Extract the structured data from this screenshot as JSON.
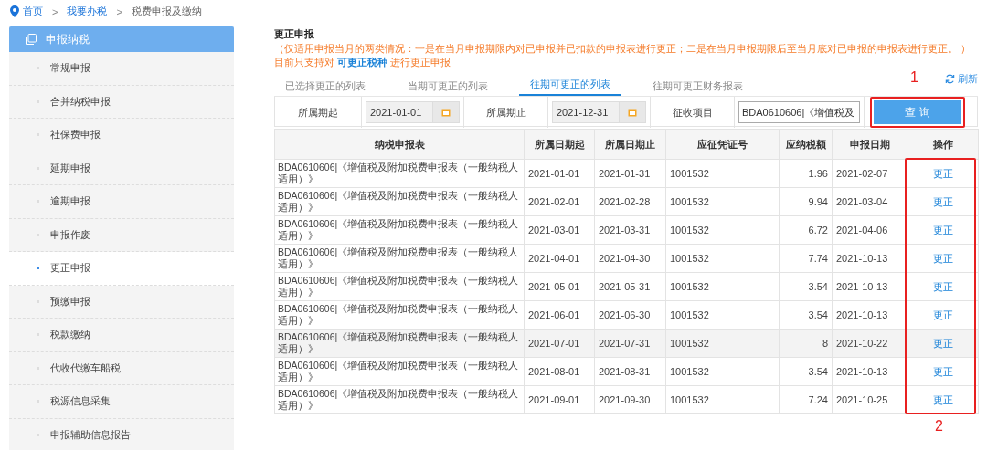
{
  "breadcrumb": [
    {
      "label": "首页",
      "link": true
    },
    {
      "label": "我要办税",
      "link": true
    },
    {
      "label": "税费申报及缴纳",
      "link": false
    }
  ],
  "breadcrumb_separator": ">",
  "sidebar": {
    "title": "申报纳税",
    "items": [
      {
        "label": "常规申报",
        "selected": false
      },
      {
        "label": "合并纳税申报",
        "selected": false
      },
      {
        "label": "社保费申报",
        "selected": false
      },
      {
        "label": "延期申报",
        "selected": false
      },
      {
        "label": "逾期申报",
        "selected": false
      },
      {
        "label": "申报作废",
        "selected": false
      },
      {
        "label": "更正申报",
        "selected": true
      },
      {
        "label": "预缴申报",
        "selected": false
      },
      {
        "label": "税款缴纳",
        "selected": false
      },
      {
        "label": "代收代缴车船税",
        "selected": false
      },
      {
        "label": "税源信息采集",
        "selected": false
      },
      {
        "label": "申报辅助信息报告",
        "selected": false
      }
    ]
  },
  "page_title": "更正申报",
  "notice": "（仅适用申报当月的两类情况：一是在当月申报期限内对已申报并已扣款的申报表进行更正；二是在当月申报期限后至当月底对已申报的申报表进行更正。 ）",
  "support_note": {
    "before": "目前只支持对",
    "link": "可更正税种",
    "after": "进行更正申报"
  },
  "tabs": [
    {
      "label": "已选择更正的列表",
      "selected": false
    },
    {
      "label": "当期可更正的列表",
      "selected": false
    },
    {
      "label": "往期可更正的列表",
      "selected": true
    },
    {
      "label": "往期可更正财务报表",
      "selected": false
    }
  ],
  "refresh": "刷新",
  "filters": {
    "start_label": "所属期起",
    "start_value": "2021-01-01",
    "end_label": "所属期止",
    "end_value": "2021-12-31",
    "item_label": "征收项目",
    "item_value": "BDA0610606|《增值税及",
    "query_button": "查 询"
  },
  "table": {
    "columns": [
      "纳税申报表",
      "所属日期起",
      "所属日期止",
      "应征凭证号",
      "应纳税额",
      "申报日期",
      "操作"
    ],
    "rows": [
      {
        "form": "BDA0610606|《增值税及附加税费申报表（一般纳税人适用）》",
        "start": "2021-01-01",
        "end": "2021-01-31",
        "voucher": "1001532",
        "amount": "1.96",
        "date": "2021-02-07",
        "action": "更正",
        "selected": false
      },
      {
        "form": "BDA0610606|《增值税及附加税费申报表（一般纳税人适用）》",
        "start": "2021-02-01",
        "end": "2021-02-28",
        "voucher": "1001532",
        "amount": "9.94",
        "date": "2021-03-04",
        "action": "更正",
        "selected": false
      },
      {
        "form": "BDA0610606|《增值税及附加税费申报表（一般纳税人适用）》",
        "start": "2021-03-01",
        "end": "2021-03-31",
        "voucher": "1001532",
        "amount": "6.72",
        "date": "2021-04-06",
        "action": "更正",
        "selected": false
      },
      {
        "form": "BDA0610606|《增值税及附加税费申报表（一般纳税人适用）》",
        "start": "2021-04-01",
        "end": "2021-04-30",
        "voucher": "1001532",
        "amount": "7.74",
        "date": "2021-10-13",
        "action": "更正",
        "selected": false
      },
      {
        "form": "BDA0610606|《增值税及附加税费申报表（一般纳税人适用）》",
        "start": "2021-05-01",
        "end": "2021-05-31",
        "voucher": "1001532",
        "amount": "3.54",
        "date": "2021-10-13",
        "action": "更正",
        "selected": false
      },
      {
        "form": "BDA0610606|《增值税及附加税费申报表（一般纳税人适用）》",
        "start": "2021-06-01",
        "end": "2021-06-30",
        "voucher": "1001532",
        "amount": "3.54",
        "date": "2021-10-13",
        "action": "更正",
        "selected": false
      },
      {
        "form": "BDA0610606|《增值税及附加税费申报表（一般纳税人适用）》",
        "start": "2021-07-01",
        "end": "2021-07-31",
        "voucher": "1001532",
        "amount": "8",
        "date": "2021-10-22",
        "action": "更正",
        "selected": true
      },
      {
        "form": "BDA0610606|《增值税及附加税费申报表（一般纳税人适用）》",
        "start": "2021-08-01",
        "end": "2021-08-31",
        "voucher": "1001532",
        "amount": "3.54",
        "date": "2021-10-13",
        "action": "更正",
        "selected": false
      },
      {
        "form": "BDA0610606|《增值税及附加税费申报表（一般纳税人适用）》",
        "start": "2021-09-01",
        "end": "2021-09-30",
        "voucher": "1001532",
        "amount": "7.24",
        "date": "2021-10-25",
        "action": "更正",
        "selected": false
      }
    ]
  },
  "annotations": [
    {
      "label": "1"
    },
    {
      "label": "2"
    }
  ]
}
